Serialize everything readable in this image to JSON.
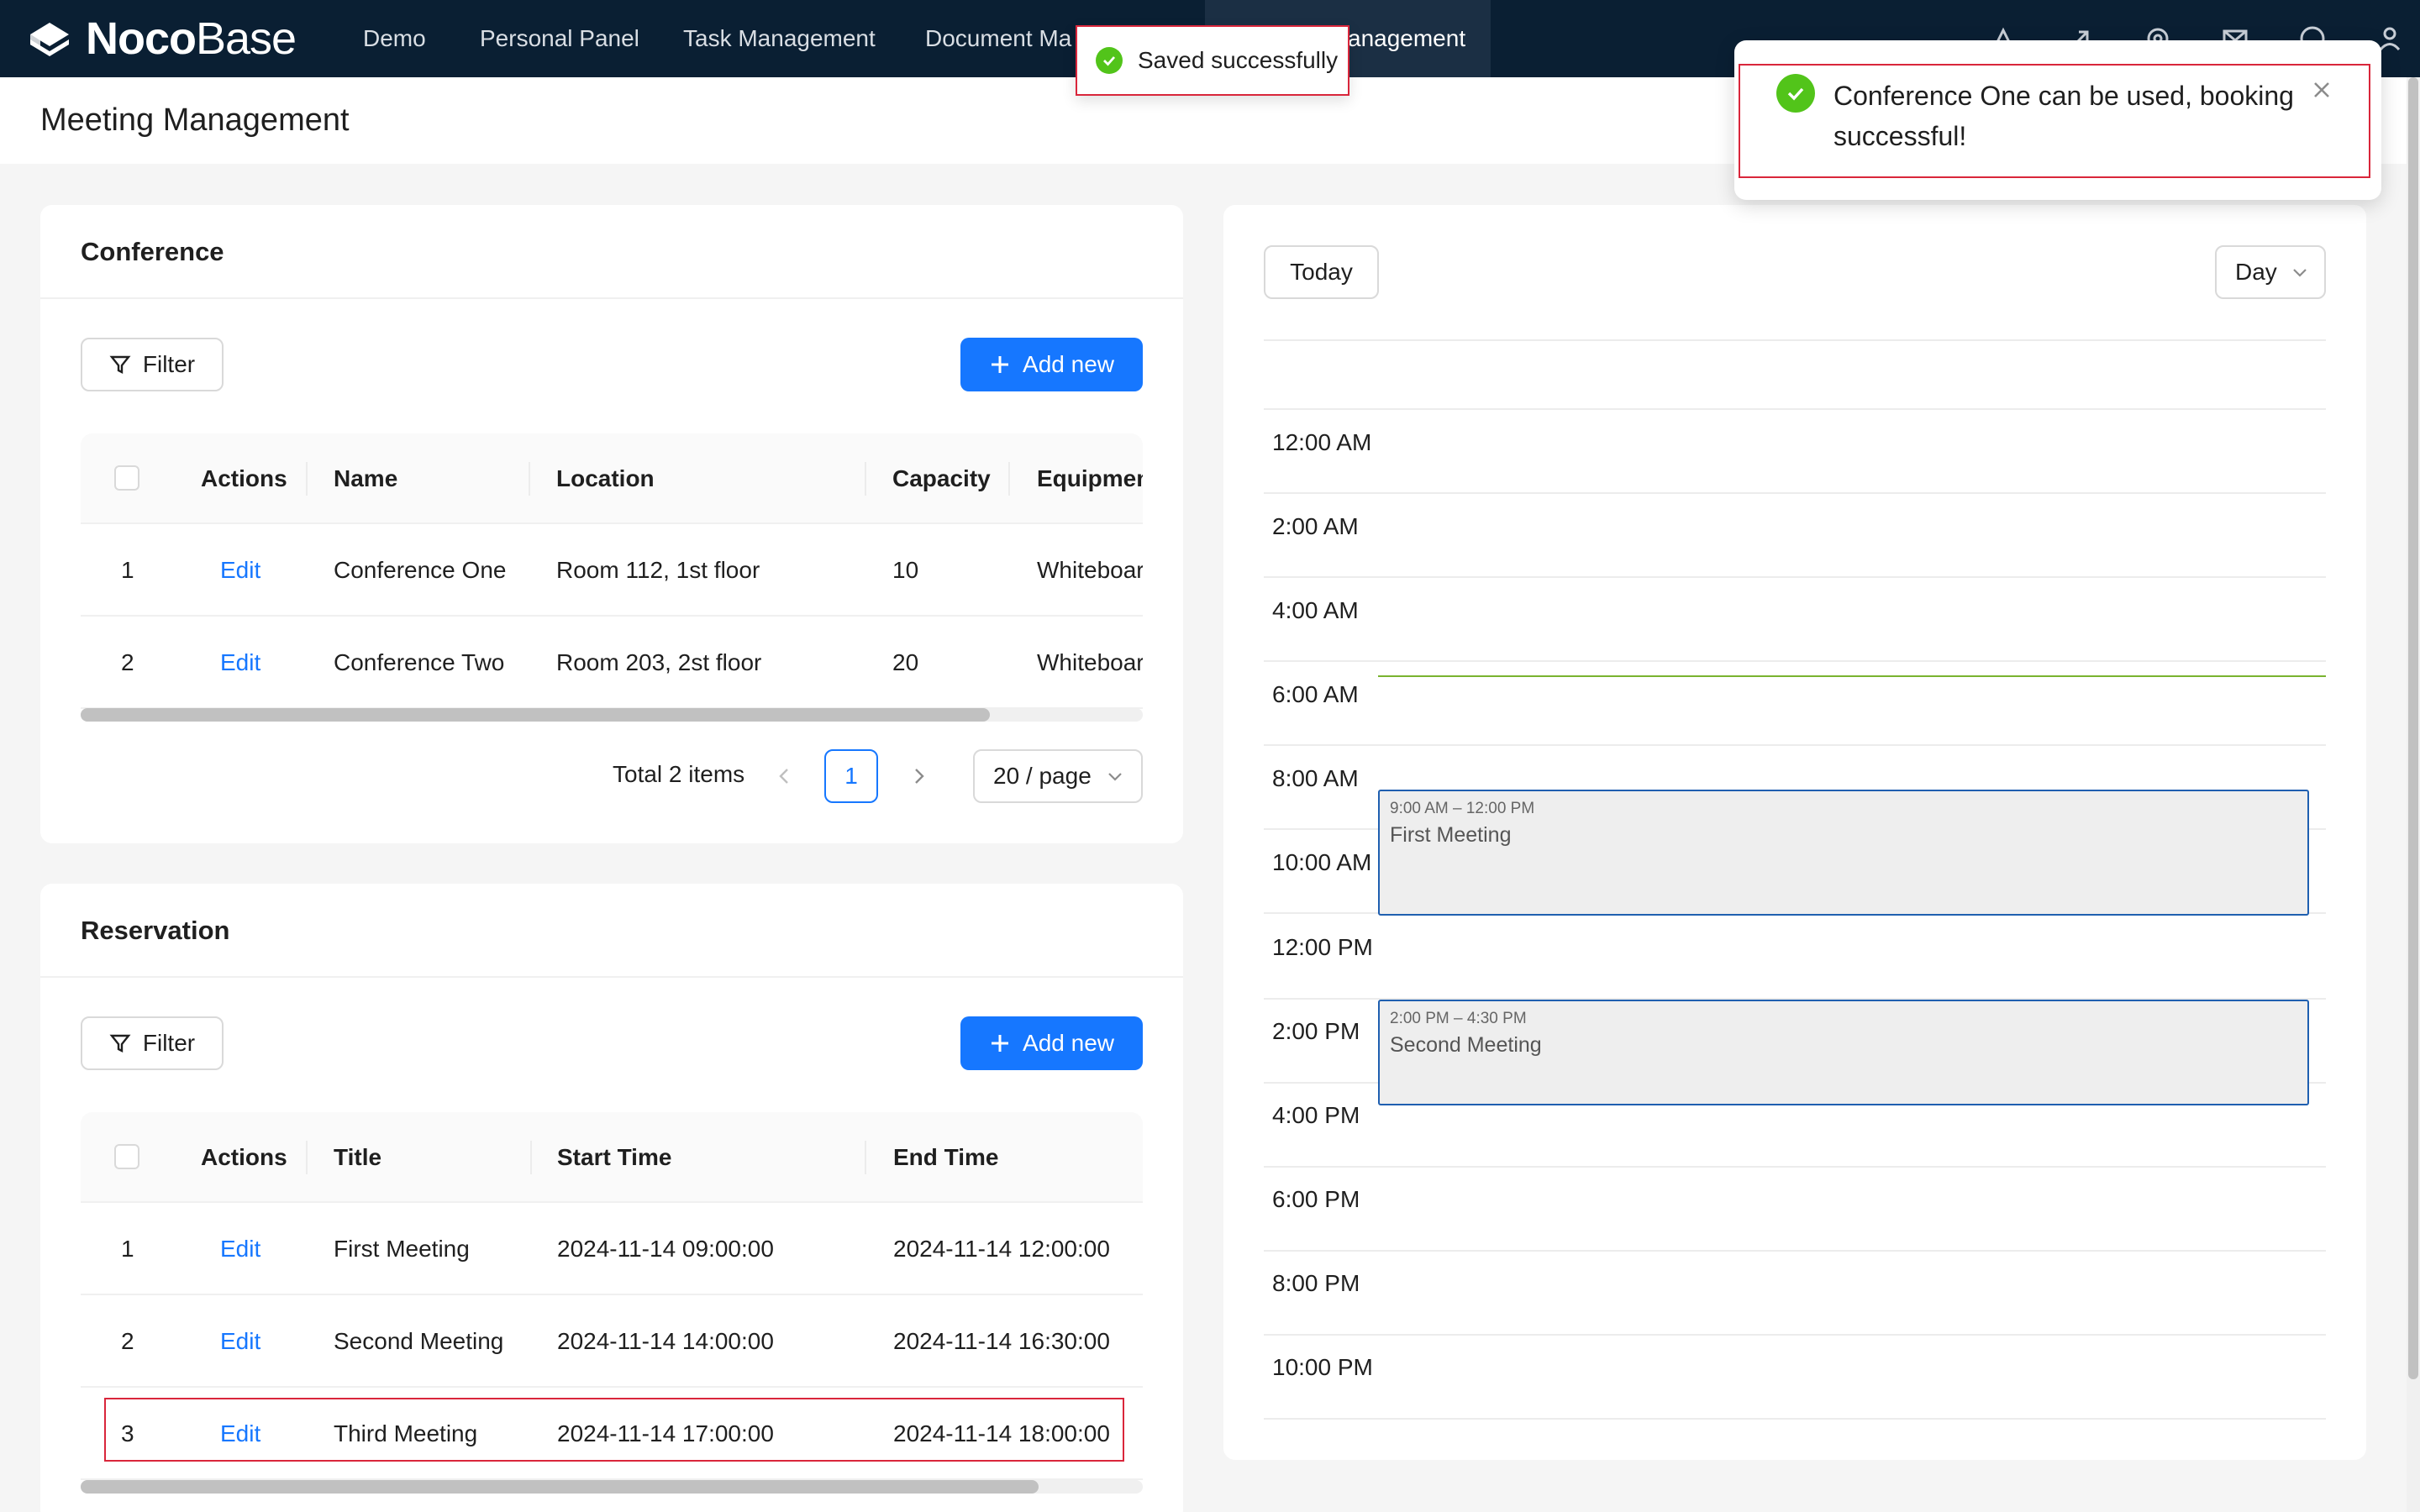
{
  "app": {
    "logo_bold": "Noco",
    "logo_light": "Base",
    "nav": [
      "Demo",
      "Personal Panel",
      "Task Management",
      "Document Ma",
      "anagement"
    ]
  },
  "page": {
    "title": "Meeting Management"
  },
  "conference": {
    "title": "Conference",
    "filter_label": "Filter",
    "add_label": "Add new",
    "columns": [
      "Actions",
      "Name",
      "Location",
      "Capacity",
      "Equipmen"
    ],
    "rows": [
      {
        "no": "1",
        "action": "Edit",
        "name": "Conference One",
        "location": "Room 112, 1st floor",
        "capacity": "10",
        "equipment": "Whiteboar"
      },
      {
        "no": "2",
        "action": "Edit",
        "name": "Conference Two",
        "location": "Room 203, 2st floor",
        "capacity": "20",
        "equipment": "Whiteboar"
      }
    ],
    "pagination": {
      "total": "Total 2 items",
      "current": "1",
      "page_size": "20 / page"
    }
  },
  "reservation": {
    "title": "Reservation",
    "filter_label": "Filter",
    "add_label": "Add new",
    "columns": [
      "Actions",
      "Title",
      "Start Time",
      "End Time"
    ],
    "rows": [
      {
        "no": "1",
        "action": "Edit",
        "title": "First Meeting",
        "start": "2024-11-14 09:00:00",
        "end": "2024-11-14 12:00:00"
      },
      {
        "no": "2",
        "action": "Edit",
        "title": "Second Meeting",
        "start": "2024-11-14 14:00:00",
        "end": "2024-11-14 16:30:00"
      },
      {
        "no": "3",
        "action": "Edit",
        "title": "Third Meeting",
        "start": "2024-11-14 17:00:00",
        "end": "2024-11-14 18:00:00"
      }
    ]
  },
  "calendar": {
    "today_label": "Today",
    "view_label": "Day",
    "hours": [
      "12:00 AM",
      "2:00 AM",
      "4:00 AM",
      "6:00 AM",
      "8:00 AM",
      "10:00 AM",
      "12:00 PM",
      "2:00 PM",
      "4:00 PM",
      "6:00 PM",
      "8:00 PM",
      "10:00 PM"
    ],
    "events": [
      {
        "time": "9:00 AM – 12:00 PM",
        "title": "First Meeting"
      },
      {
        "time": "2:00 PM – 4:30 PM",
        "title": "Second Meeting"
      }
    ]
  },
  "toasts": {
    "message": "Saved successfully",
    "notification": "Conference One can be used, booking successful!"
  },
  "colors": {
    "primary": "#1677ff",
    "nav_bg": "#0a1f33",
    "success": "#52c41a",
    "highlight": "#d9263b"
  }
}
